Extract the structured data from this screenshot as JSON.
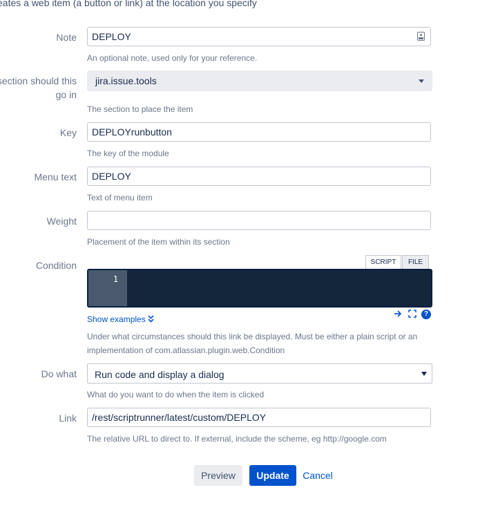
{
  "intro_text": "eates a web item (a button or link) at the location you specify",
  "note": {
    "label": "Note",
    "value": "DEPLOY",
    "help": "An optional note, used only for your reference."
  },
  "section": {
    "label": "hat section should this go in",
    "value": "jira.issue.tools",
    "help": "The section to place the item"
  },
  "key": {
    "label": "Key",
    "value": "DEPLOYrunbutton",
    "help": "The key of the module"
  },
  "menu_text": {
    "label": "Menu text",
    "value": "DEPLOY",
    "help": "Text of menu item"
  },
  "weight": {
    "label": "Weight",
    "value": "",
    "help": "Placement of the item within its section"
  },
  "condition": {
    "label": "Condition",
    "tabs": [
      "SCRIPT",
      "FILE"
    ],
    "line_number": "1",
    "show_examples": "Show examples",
    "help_line1": "Under what circumstances should this link be displayed. Must be either a plain script or an",
    "help_line2": "implementation of com.atlassian.plugin.web.Condition",
    "icons": [
      "arrow-right-icon",
      "expand-icon",
      "help-icon"
    ]
  },
  "do_what": {
    "label": "Do what",
    "value": "Run code and display a dialog",
    "help": "What do you want to do when the item is clicked"
  },
  "link": {
    "label": "Link",
    "value": "/rest/scriptrunner/latest/custom/DEPLOY",
    "help": "The relative URL to direct to. If external, include the scheme, eg http://google.com"
  },
  "buttons": {
    "preview": "Preview",
    "update": "Update",
    "cancel": "Cancel"
  },
  "colors": {
    "primary": "#0052cc",
    "editor_bg": "#14263c",
    "gutter_bg": "#4a5a6c"
  }
}
